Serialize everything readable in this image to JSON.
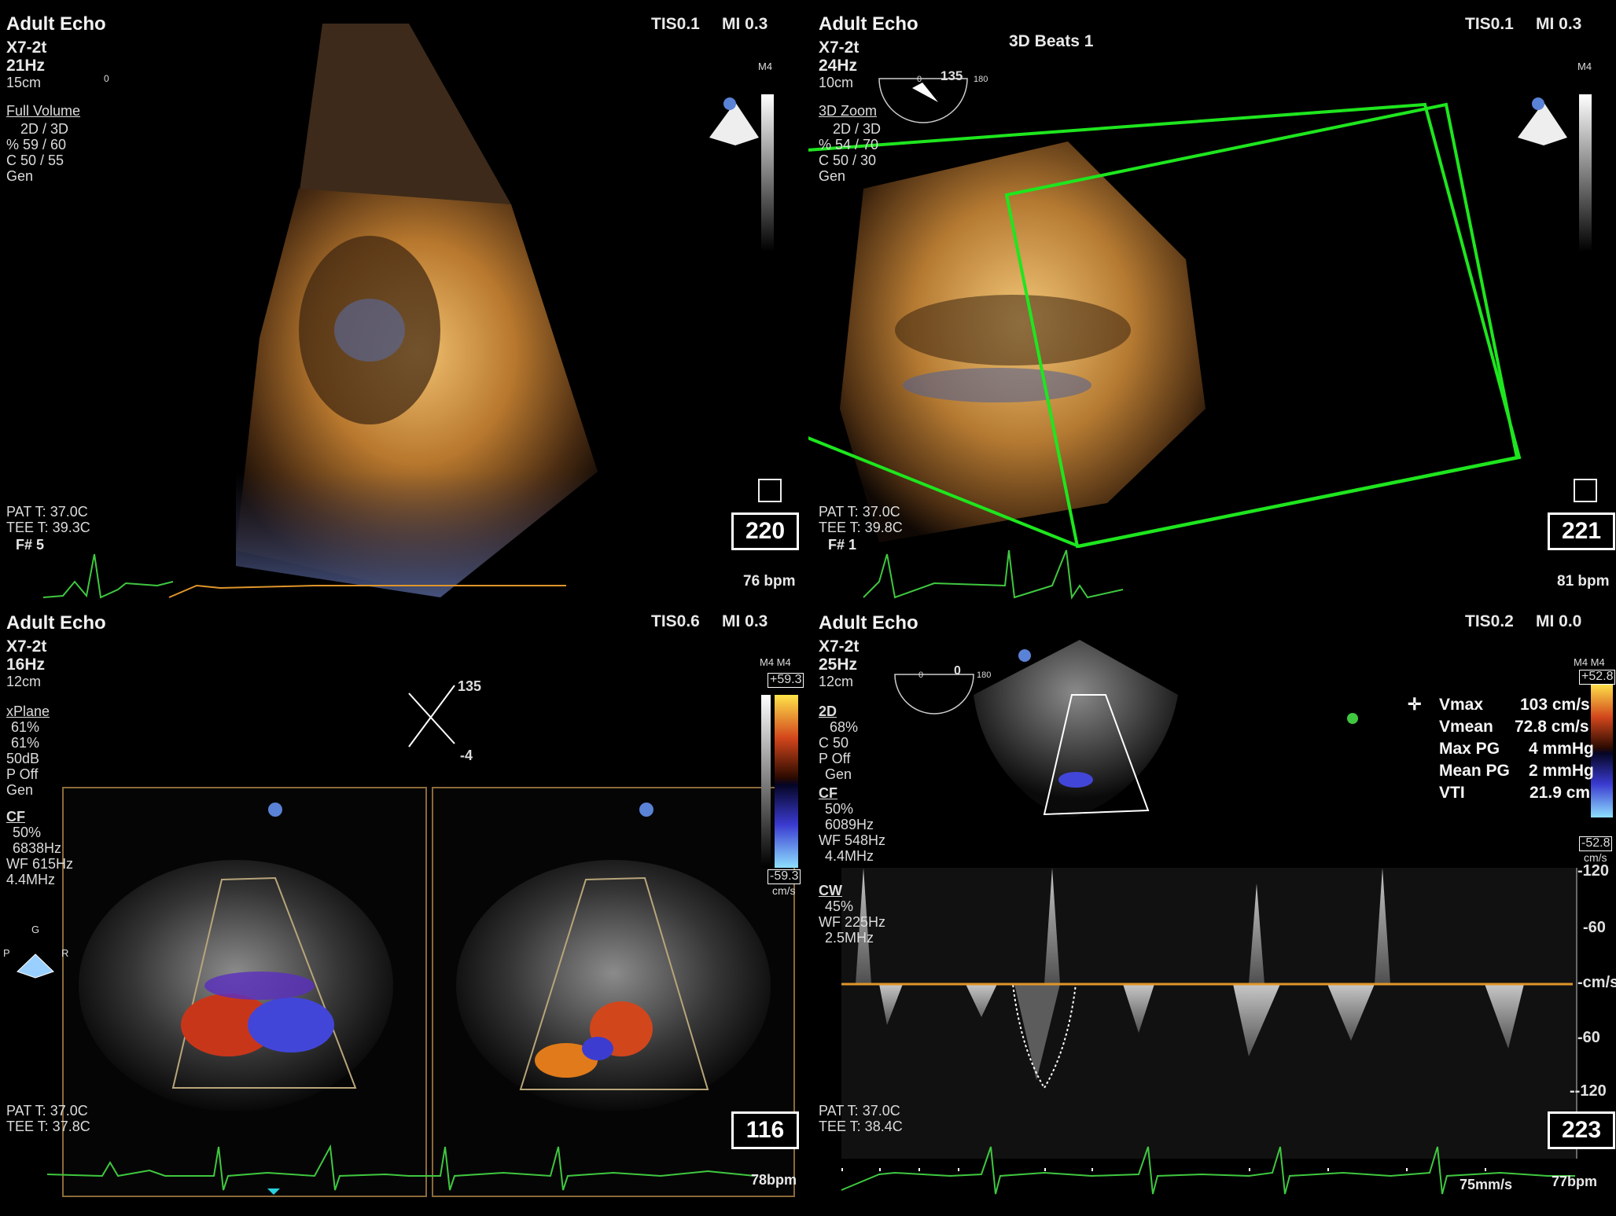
{
  "p1": {
    "title": "Adult Echo",
    "probe": "X7-2t",
    "rate": "21Hz",
    "depth": "15cm",
    "tis": "TIS0.1",
    "mi": "MI 0.3",
    "scale_label": "M4",
    "angle": "0",
    "mode": "Full Volume",
    "settings": [
      "2D / 3D",
      "% 59 / 60",
      "C  50 / 55",
      "Gen"
    ],
    "pat_t": "PAT T: 37.0C",
    "tee_t": "TEE T: 39.3C",
    "fnum": "F# 5",
    "frame": "220",
    "bpm": "76 bpm"
  },
  "p2": {
    "title": "Adult Echo",
    "probe": "X7-2t",
    "rate": "24Hz",
    "depth": "10cm",
    "tis": "TIS0.1",
    "mi": "MI 0.3",
    "scale_label": "M4",
    "beats": "3D Beats 1",
    "angle": "135",
    "angle_min": "0",
    "angle_max": "180",
    "mode": "3D Zoom",
    "settings": [
      "2D / 3D",
      "% 54 / 70",
      "C  50 / 30",
      "Gen"
    ],
    "pat_t": "PAT T: 37.0C",
    "tee_t": "TEE T: 39.8C",
    "fnum": "F# 1",
    "frame": "221",
    "bpm": "81 bpm"
  },
  "p3": {
    "title": "Adult Echo",
    "probe": "X7-2t",
    "rate": "16Hz",
    "depth": "12cm",
    "tis": "TIS0.6",
    "mi": "MI 0.3",
    "scale_label": "M4 M4",
    "vel_top": "+59.3",
    "vel_bottom": "-59.3",
    "vel_unit": "cm/s",
    "angle_a": "135",
    "angle_b": "-4",
    "mode": "xPlane",
    "settings": [
      "61%",
      "61%",
      "50dB",
      "P Off",
      "Gen"
    ],
    "cf_label": "CF",
    "cf_settings": [
      "50%",
      "6838Hz",
      "WF 615Hz",
      "4.4MHz"
    ],
    "orient_g": "G",
    "orient_p": "P",
    "orient_r": "R",
    "pat_t": "PAT T: 37.0C",
    "tee_t": "TEE T: 37.8C",
    "frame": "116",
    "bpm": "78bpm"
  },
  "p4": {
    "title": "Adult Echo",
    "probe": "X7-2t",
    "rate": "25Hz",
    "depth": "12cm",
    "tis": "TIS0.2",
    "mi": "MI 0.0",
    "scale_label": "M4 M4",
    "vel_top": "+52.8",
    "vel_bottom": "-52.8",
    "vel_unit": "cm/s",
    "angle": "0",
    "angle_min": "0",
    "angle_max": "180",
    "mode": "2D",
    "settings": [
      "68%",
      "C 50",
      "P Off",
      "Gen"
    ],
    "cf_label": "CF",
    "cf_settings": [
      "50%",
      "6089Hz",
      "WF 548Hz",
      "4.4MHz"
    ],
    "cw_label": "CW",
    "cw_settings": [
      "45%",
      "WF 225Hz",
      "2.5MHz"
    ],
    "measurements": [
      {
        "label": "Vmax",
        "value": "103 cm/s"
      },
      {
        "label": "Vmean",
        "value": "72.8 cm/s"
      },
      {
        "label": "Max PG",
        "value": "4 mmHg"
      },
      {
        "label": "Mean PG",
        "value": "2 mmHg"
      },
      {
        "label": "VTI",
        "value": "21.9 cm"
      }
    ],
    "axis_ticks": [
      "-120",
      "-60",
      "-cm/s",
      "-60",
      "--120"
    ],
    "pat_t": "PAT T: 37.0C",
    "tee_t": "TEE T: 38.4C",
    "sweep": "75mm/s",
    "frame": "223",
    "bpm": "77bpm"
  },
  "colors": {
    "ecg": "#3fc83f",
    "zoom_box": "#1ee61e",
    "baseline": "#e0962a",
    "sector": "#b8a57a"
  }
}
